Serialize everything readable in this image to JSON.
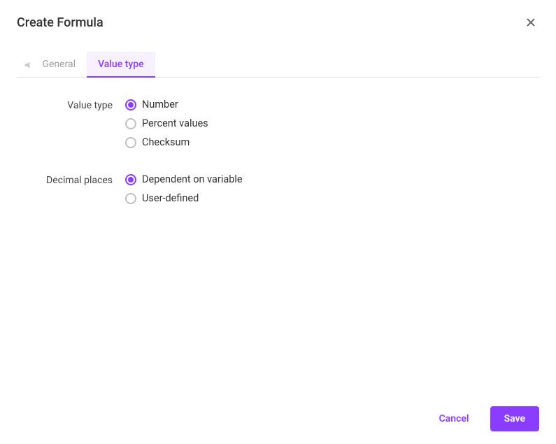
{
  "header": {
    "title": "Create Formula"
  },
  "tabs": {
    "general": {
      "label": "General",
      "active": false
    },
    "value_type": {
      "label": "Value type",
      "active": true
    }
  },
  "form": {
    "value_type": {
      "label": "Value type",
      "options": {
        "number": {
          "label": "Number",
          "checked": true
        },
        "percent": {
          "label": "Percent values",
          "checked": false
        },
        "checksum": {
          "label": "Checksum",
          "checked": false
        }
      }
    },
    "decimal_places": {
      "label": "Decimal places",
      "options": {
        "dependent": {
          "label": "Dependent on variable",
          "checked": true
        },
        "user_defined": {
          "label": "User-defined",
          "checked": false
        }
      }
    }
  },
  "footer": {
    "cancel_label": "Cancel",
    "save_label": "Save"
  }
}
